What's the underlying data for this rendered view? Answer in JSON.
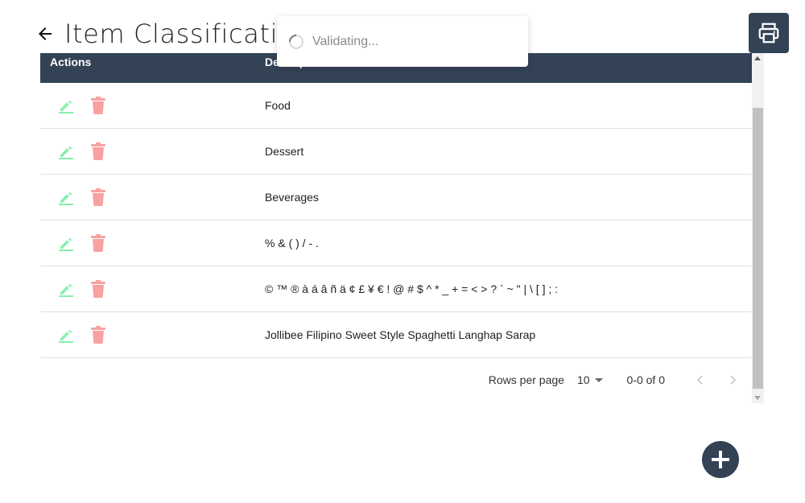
{
  "header": {
    "title": "Item Classification",
    "back_icon": "arrow-left-icon"
  },
  "toast": {
    "message": "Validating...",
    "icon": "spinner-icon"
  },
  "print_button": {
    "icon": "printer-icon"
  },
  "table": {
    "columns": {
      "actions": "Actions",
      "description": "Description"
    },
    "rows": [
      {
        "description": "Food"
      },
      {
        "description": "Dessert"
      },
      {
        "description": "Beverages"
      },
      {
        "description": "% & ( ) / - ."
      },
      {
        "description": "© ™ ® à á â ñ ä ¢ £ ¥ € ! @ # $ ^ * _ + = < > ? ` ~ \" | \\ [ ] ; :"
      },
      {
        "description": "Jollibee Filipino Sweet Style Spaghetti Langhap Sarap"
      }
    ],
    "edit_icon": "pencil-icon",
    "delete_icon": "trash-icon"
  },
  "pagination": {
    "rows_per_page_label": "Rows per page",
    "rows_per_page": "10",
    "range": "0-0 of 0"
  },
  "fab": {
    "icon": "plus-icon"
  },
  "colors": {
    "header_bg": "#344256",
    "edit": "#86efac",
    "delete": "#f8a1a1"
  }
}
